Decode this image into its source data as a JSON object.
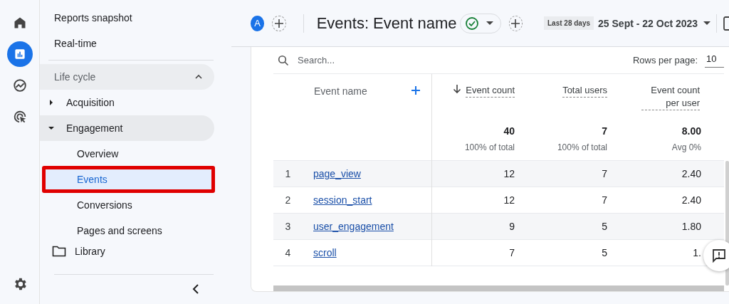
{
  "rail": {
    "items": [
      {
        "kind": "home",
        "selected": false
      },
      {
        "kind": "reports",
        "selected": true
      },
      {
        "kind": "explore",
        "selected": false
      },
      {
        "kind": "advertising",
        "selected": false
      }
    ]
  },
  "sidebar": {
    "items": [
      {
        "label": "Reports snapshot",
        "selected": false
      },
      {
        "label": "Real-time",
        "selected": false
      }
    ],
    "section": {
      "label": "Life cycle",
      "expanded": true,
      "children": [
        {
          "label": "Acquisition",
          "expanded": false
        },
        {
          "label": "Engagement",
          "expanded": true,
          "children": [
            {
              "label": "Overview",
              "selected": false,
              "highlighted": false
            },
            {
              "label": "Events",
              "selected": true,
              "highlighted": true
            },
            {
              "label": "Conversions",
              "selected": false,
              "highlighted": false
            },
            {
              "label": "Pages and screens",
              "selected": false,
              "highlighted": false
            }
          ]
        }
      ]
    },
    "library": {
      "label": "Library"
    }
  },
  "header": {
    "avatar": "A",
    "title": "Events: Event name",
    "date_chip": "Last 28 days",
    "date_range": "25 Sept - 22 Oct 2023"
  },
  "table": {
    "search": {
      "placeholder": "Search..."
    },
    "rows_per_page": {
      "label": "Rows per page:",
      "value": "10"
    },
    "columns": [
      {
        "label": "Event name",
        "kind": "dimension"
      },
      {
        "label": "Event count",
        "kind": "sorted"
      },
      {
        "label": "Total users",
        "kind": "metric"
      },
      {
        "label": "Event count per user",
        "kind": "metric"
      }
    ],
    "totals": [
      {
        "value": "40",
        "note": "100% of total"
      },
      {
        "value": "7",
        "note": "100% of total"
      },
      {
        "value": "8.00",
        "note": "Avg 0%"
      }
    ],
    "rows": [
      {
        "index": "1",
        "cells": [
          "page_view",
          "12",
          "7",
          "2.40"
        ]
      },
      {
        "index": "2",
        "cells": [
          "session_start",
          "12",
          "7",
          "2.40"
        ]
      },
      {
        "index": "3",
        "cells": [
          "user_engagement",
          "9",
          "5",
          "1.80"
        ]
      },
      {
        "index": "4",
        "cells": [
          "scroll",
          "7",
          "5",
          "1."
        ]
      }
    ]
  }
}
